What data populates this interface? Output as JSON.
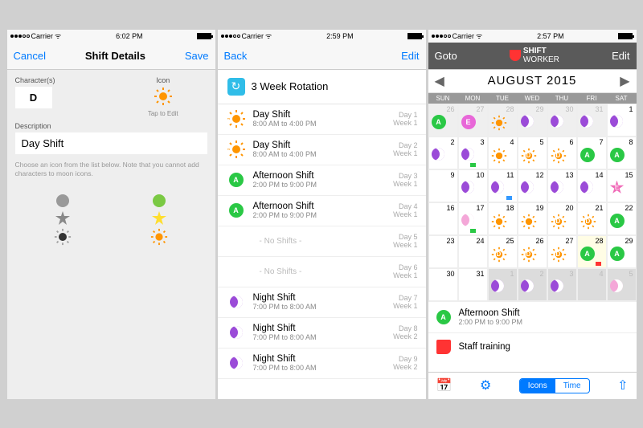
{
  "screen1": {
    "status": {
      "carrier": "Carrier",
      "wifi": "ᯤ",
      "time": "6:02 PM"
    },
    "nav": {
      "left": "Cancel",
      "title": "Shift Details",
      "right": "Save"
    },
    "char_label": "Character(s)",
    "char_value": "D",
    "icon_label": "Icon",
    "tap_hint": "Tap to Edit",
    "desc_label": "Description",
    "desc_value": "Day Shift",
    "help": "Choose an icon from the list below. Note that you cannot add characters to moon icons."
  },
  "screen2": {
    "status": {
      "carrier": "Carrier",
      "wifi": "ᯤ",
      "time": "2:59 PM"
    },
    "nav": {
      "left": "Back",
      "title": "",
      "right": "Edit"
    },
    "header": "3 Week Rotation",
    "rows": [
      {
        "type": "sun-d",
        "name": "Day Shift",
        "time": "8:00 AM to 4:00 PM",
        "day": "Day 1",
        "week": "Week 1"
      },
      {
        "type": "sun-d",
        "name": "Day Shift",
        "time": "8:00 AM to 4:00 PM",
        "day": "Day 2",
        "week": "Week 1"
      },
      {
        "type": "a",
        "name": "Afternoon Shift",
        "time": "2:00 PM to 9:00 PM",
        "day": "Day 3",
        "week": "Week 1"
      },
      {
        "type": "a",
        "name": "Afternoon Shift",
        "time": "2:00 PM to 9:00 PM",
        "day": "Day 4",
        "week": "Week 1"
      },
      {
        "type": "none",
        "name": "- No Shifts -",
        "time": "",
        "day": "Day 5",
        "week": "Week 1"
      },
      {
        "type": "none",
        "name": "- No Shifts -",
        "time": "",
        "day": "Day 6",
        "week": "Week 1"
      },
      {
        "type": "moon",
        "name": "Night Shift",
        "time": "7:00 PM to 8:00 AM",
        "day": "Day 7",
        "week": "Week 1"
      },
      {
        "type": "moon",
        "name": "Night Shift",
        "time": "7:00 PM to 8:00 AM",
        "day": "Day 8",
        "week": "Week 2"
      },
      {
        "type": "moon",
        "name": "Night Shift",
        "time": "7:00 PM to 8:00 AM",
        "day": "Day 9",
        "week": "Week 2"
      }
    ]
  },
  "screen3": {
    "status": {
      "carrier": "Carrier",
      "wifi": "ᯤ",
      "time": "2:57 PM"
    },
    "nav": {
      "left": "Goto",
      "right": "Edit"
    },
    "brand": "SHIFT",
    "brand2": "WORKER",
    "month": "AUGUST 2015",
    "weekdays": [
      "SUN",
      "MON",
      "TUE",
      "WED",
      "THU",
      "FRI",
      "SAT"
    ],
    "cells": [
      {
        "n": "26",
        "off": true,
        "ic": "a"
      },
      {
        "n": "27",
        "off": true,
        "ic": "e"
      },
      {
        "n": "28",
        "off": true,
        "ic": "sun"
      },
      {
        "n": "29",
        "off": true,
        "ic": "moon"
      },
      {
        "n": "30",
        "off": true,
        "ic": "moon"
      },
      {
        "n": "31",
        "off": true,
        "ic": "moon"
      },
      {
        "n": "1",
        "ic": "moon"
      },
      {
        "n": "2",
        "ic": "moon"
      },
      {
        "n": "3",
        "ic": "moon",
        "mark": "g"
      },
      {
        "n": "4",
        "ic": "sun"
      },
      {
        "n": "5",
        "ic": "sund"
      },
      {
        "n": "6",
        "ic": "sund"
      },
      {
        "n": "7",
        "ic": "a"
      },
      {
        "n": "8",
        "ic": "a"
      },
      {
        "n": "9"
      },
      {
        "n": "10",
        "ic": "moon"
      },
      {
        "n": "11",
        "ic": "moon",
        "mark": "b"
      },
      {
        "n": "12",
        "ic": "moon"
      },
      {
        "n": "13",
        "ic": "moon"
      },
      {
        "n": "14",
        "ic": "moon"
      },
      {
        "n": "15",
        "ic": "star"
      },
      {
        "n": "16"
      },
      {
        "n": "17",
        "ic": "moonpk",
        "mark": "g"
      },
      {
        "n": "18",
        "ic": "sun"
      },
      {
        "n": "19",
        "ic": "sun"
      },
      {
        "n": "20",
        "ic": "sund"
      },
      {
        "n": "21",
        "ic": "sund"
      },
      {
        "n": "22",
        "ic": "a"
      },
      {
        "n": "23"
      },
      {
        "n": "24"
      },
      {
        "n": "25",
        "ic": "sund"
      },
      {
        "n": "26",
        "ic": "sund"
      },
      {
        "n": "27",
        "ic": "sund"
      },
      {
        "n": "28",
        "ic": "a",
        "today": true,
        "mark": "r"
      },
      {
        "n": "29",
        "ic": "a"
      },
      {
        "n": "30"
      },
      {
        "n": "31"
      },
      {
        "n": "1",
        "off": true,
        "ic": "moon",
        "sel": true
      },
      {
        "n": "2",
        "off": true,
        "ic": "moon",
        "sel": true
      },
      {
        "n": "3",
        "off": true,
        "ic": "moon",
        "sel": true
      },
      {
        "n": "4",
        "off": true,
        "sel": true
      },
      {
        "n": "5",
        "off": true,
        "ic": "moonpk",
        "sel": true
      }
    ],
    "detail": {
      "name": "Afternoon Shift",
      "time": "2:00 PM to 9:00 PM"
    },
    "event": "Staff training",
    "seg": {
      "left": "Icons",
      "right": "Time"
    }
  }
}
